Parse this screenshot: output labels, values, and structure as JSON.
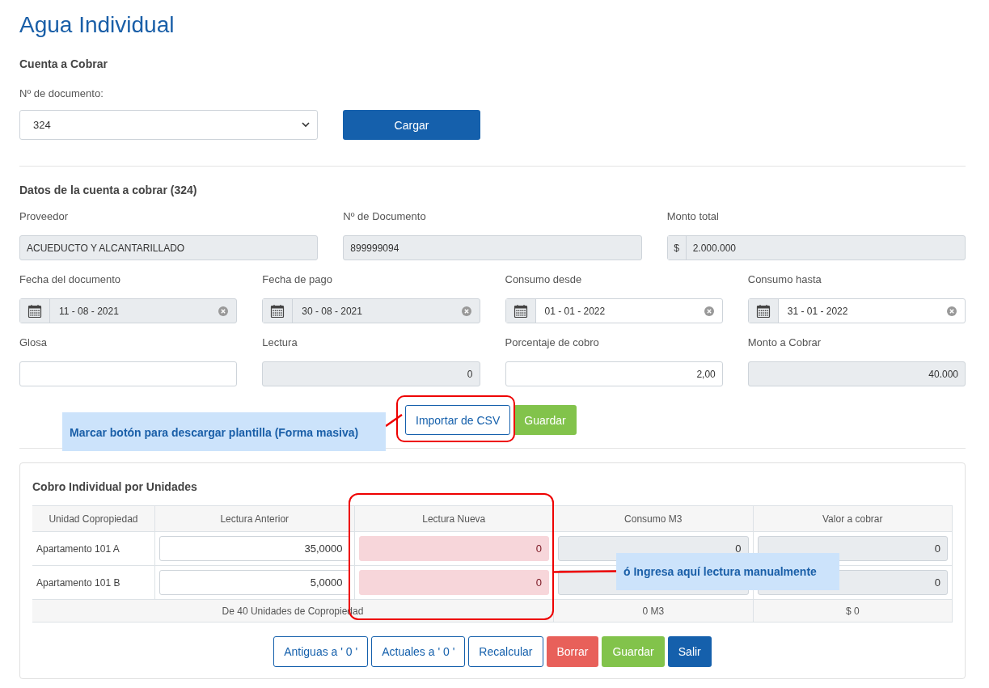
{
  "title": "Agua Individual",
  "account": {
    "heading": "Cuenta a Cobrar",
    "doc_label": "Nº de documento:",
    "doc_select": "324",
    "load_button": "Cargar"
  },
  "details": {
    "heading": "Datos de la cuenta a cobrar (324)",
    "field_rows": [
      [
        {
          "kind": "text",
          "label": "Proveedor",
          "value": "ACUEDUCTO Y ALCANTARILLADO",
          "disabled": true
        },
        {
          "kind": "text",
          "label": "Nº de Documento",
          "value": "899999094",
          "disabled": true
        },
        {
          "kind": "currency",
          "label": "Monto total",
          "prefix": "$",
          "value": "2.000.000",
          "disabled": true
        }
      ],
      [
        {
          "kind": "date",
          "label": "Fecha del documento",
          "value": "11 - 08 - 2021",
          "disabled": true
        },
        {
          "kind": "date",
          "label": "Fecha de pago",
          "value": "30 - 08 - 2021",
          "disabled": true
        },
        {
          "kind": "date",
          "label": "Consumo desde",
          "value": "01 - 01 - 2022",
          "disabled": false
        },
        {
          "kind": "date",
          "label": "Consumo hasta",
          "value": "31 - 01 - 2022",
          "disabled": false
        }
      ],
      [
        {
          "kind": "text",
          "label": "Glosa",
          "disabled": false
        },
        {
          "kind": "number",
          "label": "Lectura",
          "value": "0",
          "disabled": true
        },
        {
          "kind": "number",
          "label": "Porcentaje de cobro",
          "value": "2,00",
          "disabled": false
        },
        {
          "kind": "number",
          "label": "Monto a Cobrar",
          "value": "40.000",
          "disabled": true
        }
      ]
    ],
    "buttons": [
      {
        "label": "Importar de CSV",
        "kind": "outline"
      },
      {
        "label": "Guardar",
        "kind": "success"
      }
    ]
  },
  "units": {
    "heading": "Cobro Individual por Unidades",
    "columns": [
      "Unidad Copropiedad",
      "Lectura Anterior",
      "Lectura Nueva",
      "Consumo M3",
      "Valor a cobrar"
    ],
    "rows": [
      [
        {
          "kind": "text",
          "value": "Apartamento 101 A"
        },
        {
          "kind": "input",
          "value": "35,0000"
        },
        {
          "kind": "invalid",
          "value": "0"
        },
        {
          "kind": "readonly",
          "value": "0"
        },
        {
          "kind": "readonly",
          "value": "0"
        }
      ],
      [
        {
          "kind": "text",
          "value": "Apartamento 101 B"
        },
        {
          "kind": "input",
          "value": "5,0000"
        },
        {
          "kind": "invalid",
          "value": "0"
        },
        {
          "kind": "readonly"
        },
        {
          "kind": "readonly",
          "value": "0"
        }
      ]
    ],
    "footer": [
      "De 40 Unidades de Copropiedad",
      "0 M3",
      "$ 0"
    ],
    "buttons": [
      {
        "label": "Antiguas a ' 0 '",
        "kind": "outline"
      },
      {
        "label": "Actuales a ' 0 '",
        "kind": "outline"
      },
      {
        "label": "Recalcular",
        "kind": "outline"
      },
      {
        "label": "Borrar",
        "kind": "danger"
      },
      {
        "label": "Guardar",
        "kind": "success"
      },
      {
        "label": "Salir",
        "kind": "primary"
      }
    ]
  },
  "annotations": [
    {
      "text": "Marcar botón para descargar plantilla (Forma masiva)"
    },
    {
      "text": "ó Ingresa aquí lectura manualmente"
    }
  ]
}
